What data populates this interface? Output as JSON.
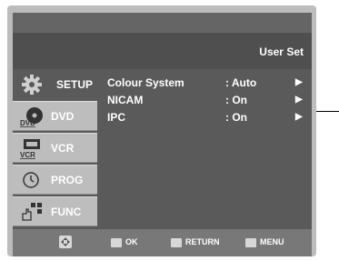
{
  "header": {
    "title": "User Set"
  },
  "sidebar": {
    "items": [
      {
        "label": "SETUP",
        "icon": "gear-icon",
        "active": true
      },
      {
        "label": "DVD",
        "icon": "dvd-icon",
        "badge": "DVD"
      },
      {
        "label": "VCR",
        "icon": "vcr-icon",
        "badge": "VCR"
      },
      {
        "label": "PROG",
        "icon": "clock-icon"
      },
      {
        "label": "FUNC",
        "icon": "function-icon"
      }
    ]
  },
  "menu": {
    "rows": [
      {
        "name": "Colour System",
        "value": ": Auto",
        "arrow": "▶"
      },
      {
        "name": "NICAM",
        "value": ": On",
        "arrow": "▶"
      },
      {
        "name": "IPC",
        "value": ": On",
        "arrow": "▶"
      }
    ]
  },
  "footer": {
    "ok": "OK",
    "return": "RETURN",
    "menu": "MENU"
  },
  "colors": {
    "screen": "#5a5a5a",
    "sidebar": "#bdbdbd",
    "footer": "#787878"
  }
}
